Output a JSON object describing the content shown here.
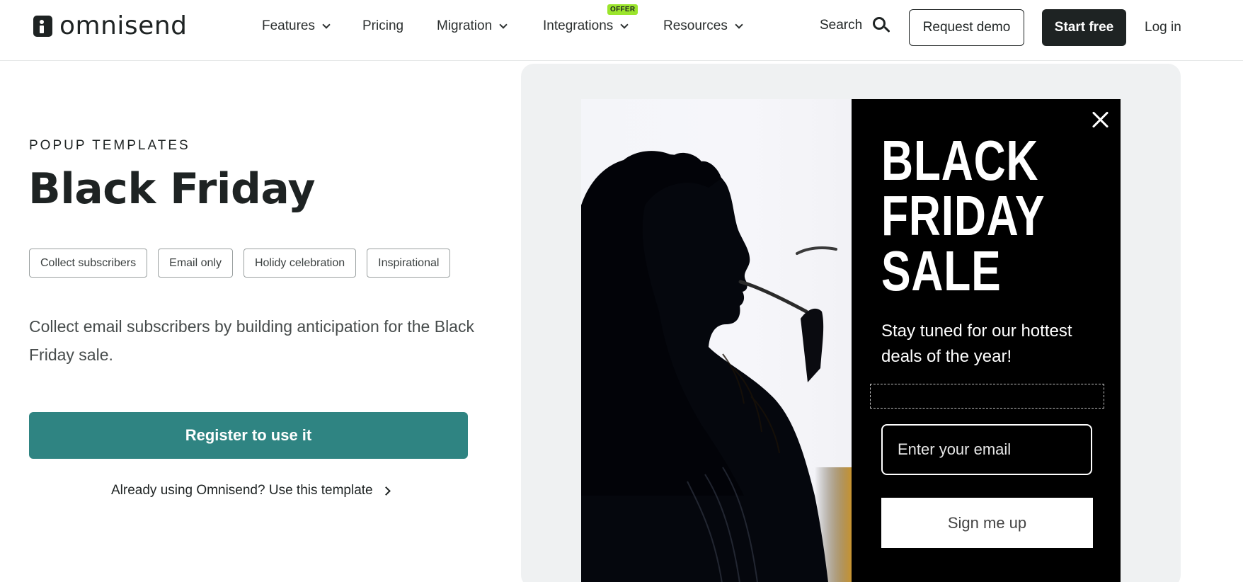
{
  "header": {
    "logo_text": "omnisend",
    "nav": [
      {
        "label": "Features",
        "has_dropdown": true
      },
      {
        "label": "Pricing",
        "has_dropdown": false
      },
      {
        "label": "Migration",
        "has_dropdown": true
      },
      {
        "label": "Integrations",
        "has_dropdown": true,
        "badge": "OFFER"
      },
      {
        "label": "Resources",
        "has_dropdown": true
      }
    ],
    "search_label": "Search",
    "request_demo_label": "Request demo",
    "start_free_label": "Start free",
    "login_label": "Log in"
  },
  "main": {
    "eyebrow": "POPUP TEMPLATES",
    "title": "Black Friday",
    "tags": [
      "Collect subscribers",
      "Email only",
      "Holidy celebration",
      "Inspirational"
    ],
    "description": "Collect email subscribers by building anticipation for the Black Friday sale.",
    "register_label": "Register to use it",
    "already_using_label": "Already using Omnisend? Use this template"
  },
  "popup": {
    "headline_line1": "BLACK",
    "headline_line2": "FRIDAY",
    "headline_line3": "SALE",
    "subtext": "Stay tuned for our hottest deals of the year!",
    "email_placeholder": "Enter your email",
    "signup_label": "Sign me up"
  },
  "colors": {
    "brand_dark": "#1e2323",
    "cta_teal": "#2f8482",
    "offer_badge": "#9be52c",
    "preview_bg": "#eff1f2",
    "popup_bg": "#000000"
  },
  "icons": [
    "logo-icon",
    "chevron-down-icon",
    "search-icon",
    "chevron-right-icon",
    "close-icon"
  ]
}
